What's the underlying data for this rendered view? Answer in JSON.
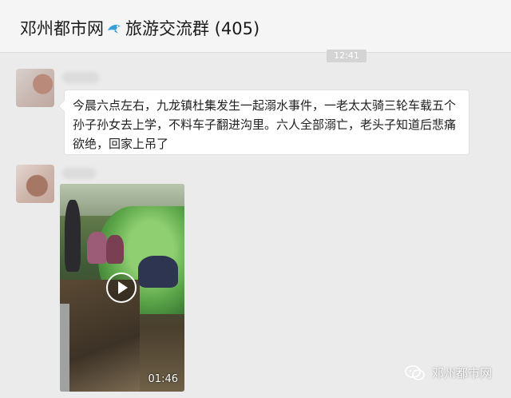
{
  "header": {
    "group_name": "邓州都市网",
    "group_suffix": "旅游交流群 (405)"
  },
  "chat": {
    "timestamp": "12:41",
    "messages": [
      {
        "type": "text",
        "text": "今晨六点左右，九龙镇杜集发生一起溺水事件，一老太太骑三轮车载五个孙子孙女去上学，不料车子翻进沟里。六人全部溺亡，老头子知道后悲痛欲绝，回家上吊了"
      },
      {
        "type": "video",
        "duration": "01:46",
        "icon": "play-icon"
      }
    ]
  },
  "watermark": {
    "text": "邓州都市网",
    "icon": "wechat-icon"
  },
  "colors": {
    "background": "#ebebeb",
    "header": "#f5f5f5",
    "bubble": "#ffffff"
  }
}
